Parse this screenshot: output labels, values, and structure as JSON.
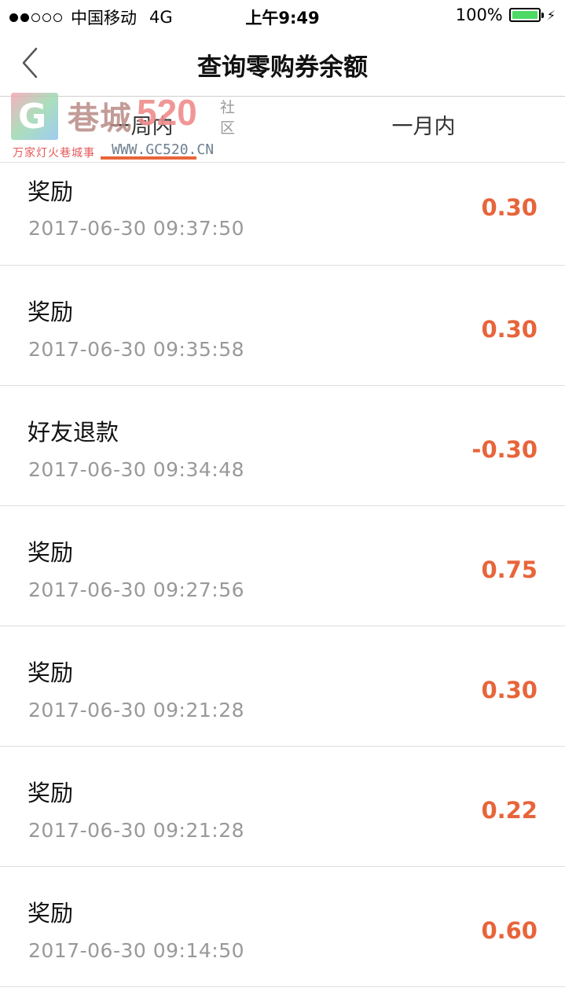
{
  "status_bar": {
    "carrier": "中国移动",
    "network": "4G",
    "time": "上午9:49",
    "battery": "100%",
    "battery_level": 1.0,
    "signal_bars": 2,
    "signal_total": 5
  },
  "nav": {
    "title": "查询零购券余额",
    "back_icon": "chevron-left-icon"
  },
  "tabs": [
    {
      "label": "一周内",
      "active": true
    },
    {
      "label": "一月内",
      "active": false
    }
  ],
  "watermark": {
    "logo_letter": "G",
    "name": "巷城",
    "number": "520",
    "she": "社",
    "qu": "区",
    "slogan": "万家灯火巷城事",
    "url": "WWW.GC520.CN"
  },
  "colors": {
    "accent": "#e9653a",
    "amount": "#e8643a",
    "battery": "#4cd964"
  },
  "records": [
    {
      "title": "奖励",
      "time": "2017-06-30 09:37:50",
      "amount": "0.30"
    },
    {
      "title": "奖励",
      "time": "2017-06-30 09:35:58",
      "amount": "0.30"
    },
    {
      "title": "好友退款",
      "time": "2017-06-30 09:34:48",
      "amount": "-0.30"
    },
    {
      "title": "奖励",
      "time": "2017-06-30 09:27:56",
      "amount": "0.75"
    },
    {
      "title": "奖励",
      "time": "2017-06-30 09:21:28",
      "amount": "0.30"
    },
    {
      "title": "奖励",
      "time": "2017-06-30 09:21:28",
      "amount": "0.22"
    },
    {
      "title": "奖励",
      "time": "2017-06-30 09:14:50",
      "amount": "0.60"
    }
  ]
}
